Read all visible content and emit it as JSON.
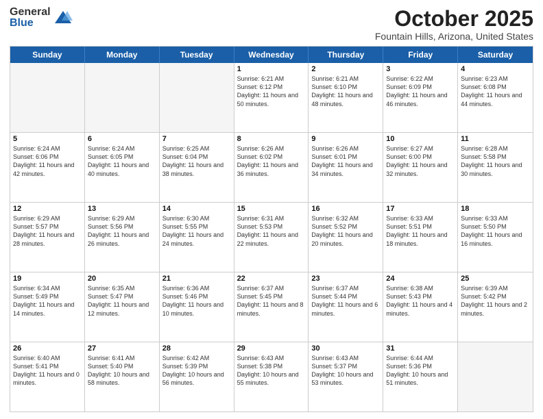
{
  "logo": {
    "general": "General",
    "blue": "Blue"
  },
  "title": "October 2025",
  "location": "Fountain Hills, Arizona, United States",
  "weekdays": [
    "Sunday",
    "Monday",
    "Tuesday",
    "Wednesday",
    "Thursday",
    "Friday",
    "Saturday"
  ],
  "weeks": [
    [
      {
        "day": "",
        "text": ""
      },
      {
        "day": "",
        "text": ""
      },
      {
        "day": "",
        "text": ""
      },
      {
        "day": "1",
        "text": "Sunrise: 6:21 AM\nSunset: 6:12 PM\nDaylight: 11 hours\nand 50 minutes."
      },
      {
        "day": "2",
        "text": "Sunrise: 6:21 AM\nSunset: 6:10 PM\nDaylight: 11 hours\nand 48 minutes."
      },
      {
        "day": "3",
        "text": "Sunrise: 6:22 AM\nSunset: 6:09 PM\nDaylight: 11 hours\nand 46 minutes."
      },
      {
        "day": "4",
        "text": "Sunrise: 6:23 AM\nSunset: 6:08 PM\nDaylight: 11 hours\nand 44 minutes."
      }
    ],
    [
      {
        "day": "5",
        "text": "Sunrise: 6:24 AM\nSunset: 6:06 PM\nDaylight: 11 hours\nand 42 minutes."
      },
      {
        "day": "6",
        "text": "Sunrise: 6:24 AM\nSunset: 6:05 PM\nDaylight: 11 hours\nand 40 minutes."
      },
      {
        "day": "7",
        "text": "Sunrise: 6:25 AM\nSunset: 6:04 PM\nDaylight: 11 hours\nand 38 minutes."
      },
      {
        "day": "8",
        "text": "Sunrise: 6:26 AM\nSunset: 6:02 PM\nDaylight: 11 hours\nand 36 minutes."
      },
      {
        "day": "9",
        "text": "Sunrise: 6:26 AM\nSunset: 6:01 PM\nDaylight: 11 hours\nand 34 minutes."
      },
      {
        "day": "10",
        "text": "Sunrise: 6:27 AM\nSunset: 6:00 PM\nDaylight: 11 hours\nand 32 minutes."
      },
      {
        "day": "11",
        "text": "Sunrise: 6:28 AM\nSunset: 5:58 PM\nDaylight: 11 hours\nand 30 minutes."
      }
    ],
    [
      {
        "day": "12",
        "text": "Sunrise: 6:29 AM\nSunset: 5:57 PM\nDaylight: 11 hours\nand 28 minutes."
      },
      {
        "day": "13",
        "text": "Sunrise: 6:29 AM\nSunset: 5:56 PM\nDaylight: 11 hours\nand 26 minutes."
      },
      {
        "day": "14",
        "text": "Sunrise: 6:30 AM\nSunset: 5:55 PM\nDaylight: 11 hours\nand 24 minutes."
      },
      {
        "day": "15",
        "text": "Sunrise: 6:31 AM\nSunset: 5:53 PM\nDaylight: 11 hours\nand 22 minutes."
      },
      {
        "day": "16",
        "text": "Sunrise: 6:32 AM\nSunset: 5:52 PM\nDaylight: 11 hours\nand 20 minutes."
      },
      {
        "day": "17",
        "text": "Sunrise: 6:33 AM\nSunset: 5:51 PM\nDaylight: 11 hours\nand 18 minutes."
      },
      {
        "day": "18",
        "text": "Sunrise: 6:33 AM\nSunset: 5:50 PM\nDaylight: 11 hours\nand 16 minutes."
      }
    ],
    [
      {
        "day": "19",
        "text": "Sunrise: 6:34 AM\nSunset: 5:49 PM\nDaylight: 11 hours\nand 14 minutes."
      },
      {
        "day": "20",
        "text": "Sunrise: 6:35 AM\nSunset: 5:47 PM\nDaylight: 11 hours\nand 12 minutes."
      },
      {
        "day": "21",
        "text": "Sunrise: 6:36 AM\nSunset: 5:46 PM\nDaylight: 11 hours\nand 10 minutes."
      },
      {
        "day": "22",
        "text": "Sunrise: 6:37 AM\nSunset: 5:45 PM\nDaylight: 11 hours\nand 8 minutes."
      },
      {
        "day": "23",
        "text": "Sunrise: 6:37 AM\nSunset: 5:44 PM\nDaylight: 11 hours\nand 6 minutes."
      },
      {
        "day": "24",
        "text": "Sunrise: 6:38 AM\nSunset: 5:43 PM\nDaylight: 11 hours\nand 4 minutes."
      },
      {
        "day": "25",
        "text": "Sunrise: 6:39 AM\nSunset: 5:42 PM\nDaylight: 11 hours\nand 2 minutes."
      }
    ],
    [
      {
        "day": "26",
        "text": "Sunrise: 6:40 AM\nSunset: 5:41 PM\nDaylight: 11 hours\nand 0 minutes."
      },
      {
        "day": "27",
        "text": "Sunrise: 6:41 AM\nSunset: 5:40 PM\nDaylight: 10 hours\nand 58 minutes."
      },
      {
        "day": "28",
        "text": "Sunrise: 6:42 AM\nSunset: 5:39 PM\nDaylight: 10 hours\nand 56 minutes."
      },
      {
        "day": "29",
        "text": "Sunrise: 6:43 AM\nSunset: 5:38 PM\nDaylight: 10 hours\nand 55 minutes."
      },
      {
        "day": "30",
        "text": "Sunrise: 6:43 AM\nSunset: 5:37 PM\nDaylight: 10 hours\nand 53 minutes."
      },
      {
        "day": "31",
        "text": "Sunrise: 6:44 AM\nSunset: 5:36 PM\nDaylight: 10 hours\nand 51 minutes."
      },
      {
        "day": "",
        "text": ""
      }
    ]
  ]
}
